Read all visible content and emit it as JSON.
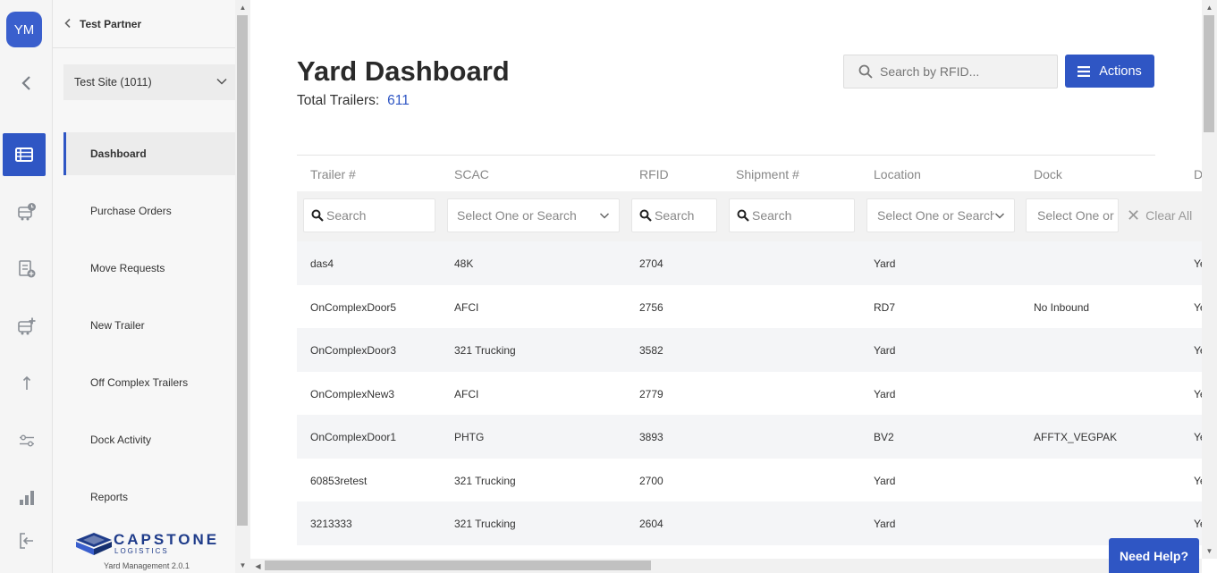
{
  "user": {
    "initials": "YM"
  },
  "rail": {
    "icons": [
      "chevron-left-icon",
      "dashboard-list-icon",
      "trailer-clock-icon",
      "purchase-order-add-icon",
      "trailer-add-icon",
      "move-up-icon",
      "sliders-icon",
      "bar-chart-icon",
      "logout-icon"
    ]
  },
  "sidebar": {
    "partner": "Test Partner",
    "site": "Test Site (1011)",
    "items": [
      {
        "label": "Dashboard",
        "active": true
      },
      {
        "label": "Purchase Orders",
        "active": false
      },
      {
        "label": "Move Requests",
        "active": false
      },
      {
        "label": "New Trailer",
        "active": false
      },
      {
        "label": "Off Complex Trailers",
        "active": false
      },
      {
        "label": "Dock Activity",
        "active": false
      },
      {
        "label": "Reports",
        "active": false
      }
    ],
    "brand": {
      "name": "CAPSTONE",
      "sub": "LOGISTICS",
      "version": "Yard Management 2.0.1"
    }
  },
  "header": {
    "title": "Yard Dashboard",
    "total_label": "Total Trailers:",
    "total_value": "611",
    "search_placeholder": "Search by RFID...",
    "actions_label": "Actions"
  },
  "table": {
    "columns": [
      "Trailer #",
      "SCAC",
      "RFID",
      "Shipment #",
      "Location",
      "Dock",
      "D"
    ],
    "filters": {
      "trailer": "Search",
      "scac": "Select One or Search",
      "rfid": "Search",
      "shipment": "Search",
      "location": "Select One or Search",
      "dock": "Select One or Search",
      "clear_all": "Clear All"
    },
    "rows": [
      {
        "trailer": "das4",
        "scac": "48K",
        "rfid": "2704",
        "shipment": "",
        "location": "Yard",
        "dock": "",
        "d": "Ye"
      },
      {
        "trailer": "OnComplexDoor5",
        "scac": "AFCI",
        "rfid": "2756",
        "shipment": "",
        "location": "RD7",
        "dock": "No Inbound",
        "d": "Ye"
      },
      {
        "trailer": "OnComplexDoor3",
        "scac": "321 Trucking",
        "rfid": "3582",
        "shipment": "",
        "location": "Yard",
        "dock": "",
        "d": "Ye"
      },
      {
        "trailer": "OnComplexNew3",
        "scac": "AFCI",
        "rfid": "2779",
        "shipment": "",
        "location": "Yard",
        "dock": "",
        "d": "Ye"
      },
      {
        "trailer": "OnComplexDoor1",
        "scac": "PHTG",
        "rfid": "3893",
        "shipment": "",
        "location": "BV2",
        "dock": "AFFTX_VEGPAK",
        "d": "Ye"
      },
      {
        "trailer": "60853retest",
        "scac": "321 Trucking",
        "rfid": "2700",
        "shipment": "",
        "location": "Yard",
        "dock": "",
        "d": "Ye"
      },
      {
        "trailer": "3213333",
        "scac": "321 Trucking",
        "rfid": "2604",
        "shipment": "",
        "location": "Yard",
        "dock": "",
        "d": "Ye"
      }
    ]
  },
  "help": {
    "label": "Need Help?"
  },
  "colors": {
    "accent": "#2f56c4",
    "row_alt": "#f4f5f7"
  }
}
